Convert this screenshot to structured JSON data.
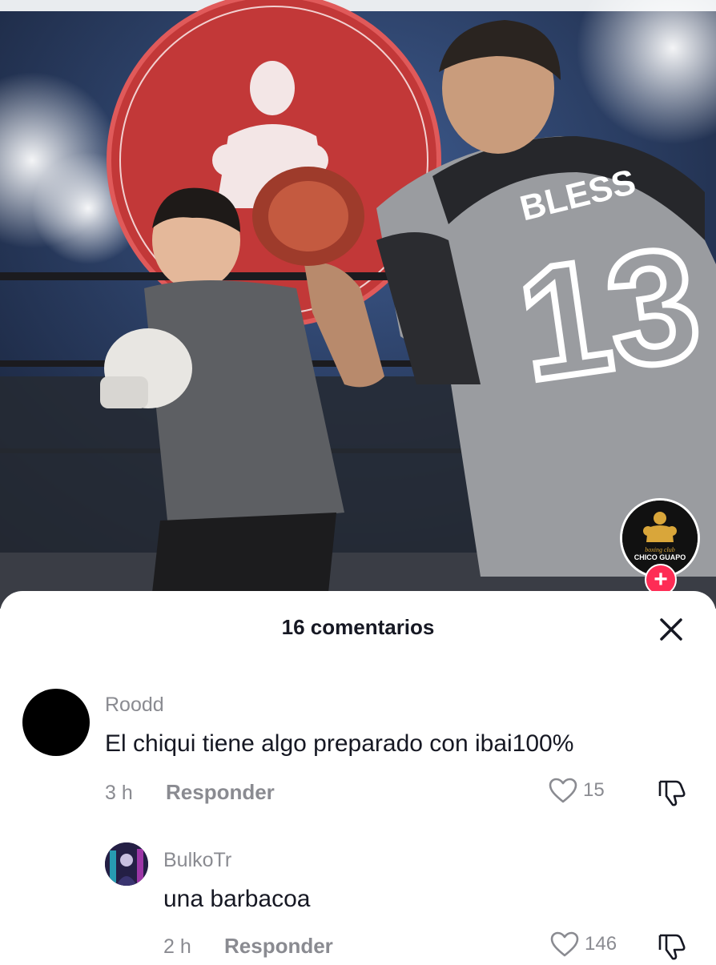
{
  "video": {
    "jersey_name": "BLESS",
    "jersey_number": "13",
    "creator_badge_text": "CHICO GUAPO",
    "creator_badge_subtext": "boxing club",
    "follow_symbol": "+",
    "icon_follow": "plus-icon"
  },
  "comments_panel": {
    "title": "16 comentarios",
    "icon_close": "close-icon"
  },
  "comments": [
    {
      "user": "Roodd",
      "text": "El chiqui tiene algo preparado con ibai100%",
      "time": "3 h",
      "reply_label": "Responder",
      "likes": "15",
      "avatar_color": "#000000"
    },
    {
      "user": "BulkoTr",
      "text": "una barbacoa",
      "time": "2 h",
      "reply_label": "Responder",
      "likes": "146",
      "avatar_color": "#2b2350"
    }
  ],
  "colors": {
    "accent": "#fe2c55",
    "text_primary": "#161823",
    "text_secondary": "#8a8b91"
  }
}
